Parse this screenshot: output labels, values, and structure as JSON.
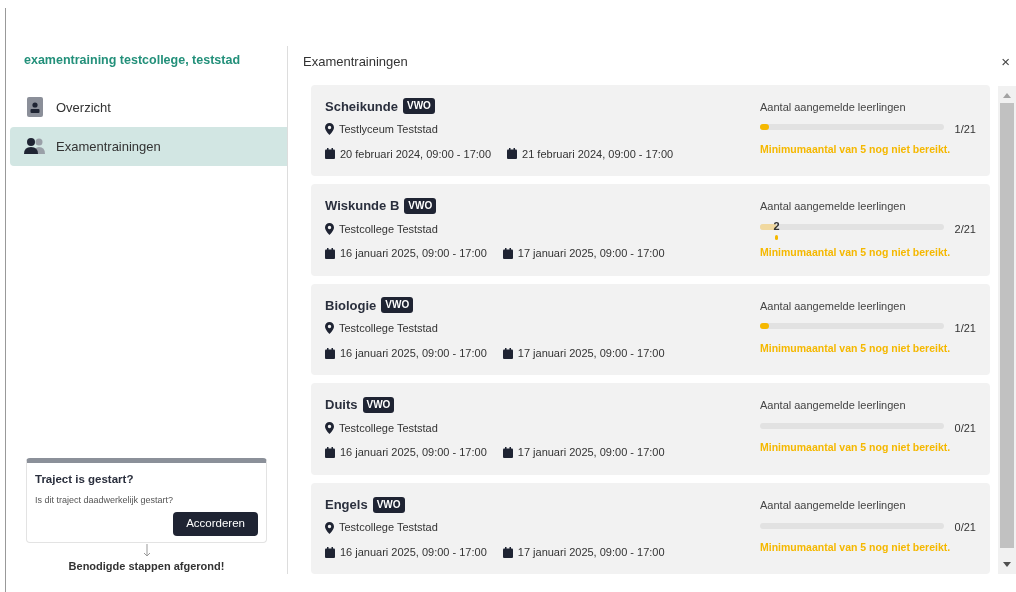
{
  "sidebar": {
    "title": "examentraining testcollege, teststad",
    "items": [
      {
        "label": "Overzicht",
        "selected": false
      },
      {
        "label": "Examentrainingen",
        "selected": true
      }
    ],
    "step_card": {
      "title": "Traject is gestart?",
      "text": "Is dit traject daadwerkelijk gestart?",
      "button": "Accorderen"
    },
    "footer": "Benodigde stappen afgerond!"
  },
  "main": {
    "title": "Examentrainingen",
    "close": "×",
    "trainings": [
      {
        "name": "Scheikunde",
        "badge": "VWO",
        "location": "Testlyceum Teststad",
        "dates": [
          "20 februari 2024, 09:00 - 17:00",
          "21 februari 2024, 09:00 - 17:00"
        ],
        "count_label": "Aantal aangemelde leerlingen",
        "level": 0.048,
        "count": "1/21",
        "warning": "Minimumaantal van 5 nog niet bereikt."
      },
      {
        "name": "Wiskunde B",
        "badge": "VWO",
        "location": "Testcollege Teststad",
        "dates": [
          "16 januari 2025, 09:00 - 17:00",
          "17 januari 2025, 09:00 - 17:00"
        ],
        "count_label": "Aantal aangemelde leerlingen",
        "level": 0.095,
        "tooltip": "2",
        "count": "2/21",
        "warning": "Minimumaantal van 5 nog niet bereikt."
      },
      {
        "name": "Biologie",
        "badge": "VWO",
        "location": "Testcollege Teststad",
        "dates": [
          "16 januari 2025, 09:00 - 17:00",
          "17 januari 2025, 09:00 - 17:00"
        ],
        "count_label": "Aantal aangemelde leerlingen",
        "level": 0.048,
        "count": "1/21",
        "warning": "Minimumaantal van 5 nog niet bereikt."
      },
      {
        "name": "Duits",
        "badge": "VWO",
        "location": "Testcollege Teststad",
        "dates": [
          "16 januari 2025, 09:00 - 17:00",
          "17 januari 2025, 09:00 - 17:00"
        ],
        "count_label": "Aantal aangemelde leerlingen",
        "level": 0,
        "count": "0/21",
        "warning": "Minimumaantal van 5 nog niet bereikt."
      },
      {
        "name": "Engels",
        "badge": "VWO",
        "location": "Testcollege Teststad",
        "dates": [
          "16 januari 2025, 09:00 - 17:00",
          "17 januari 2025, 09:00 - 17:00"
        ],
        "count_label": "Aantal aangemelde leerlingen",
        "level": 0,
        "count": "0/21",
        "warning": "Minimumaantal van 5 nog niet bereikt."
      }
    ]
  }
}
